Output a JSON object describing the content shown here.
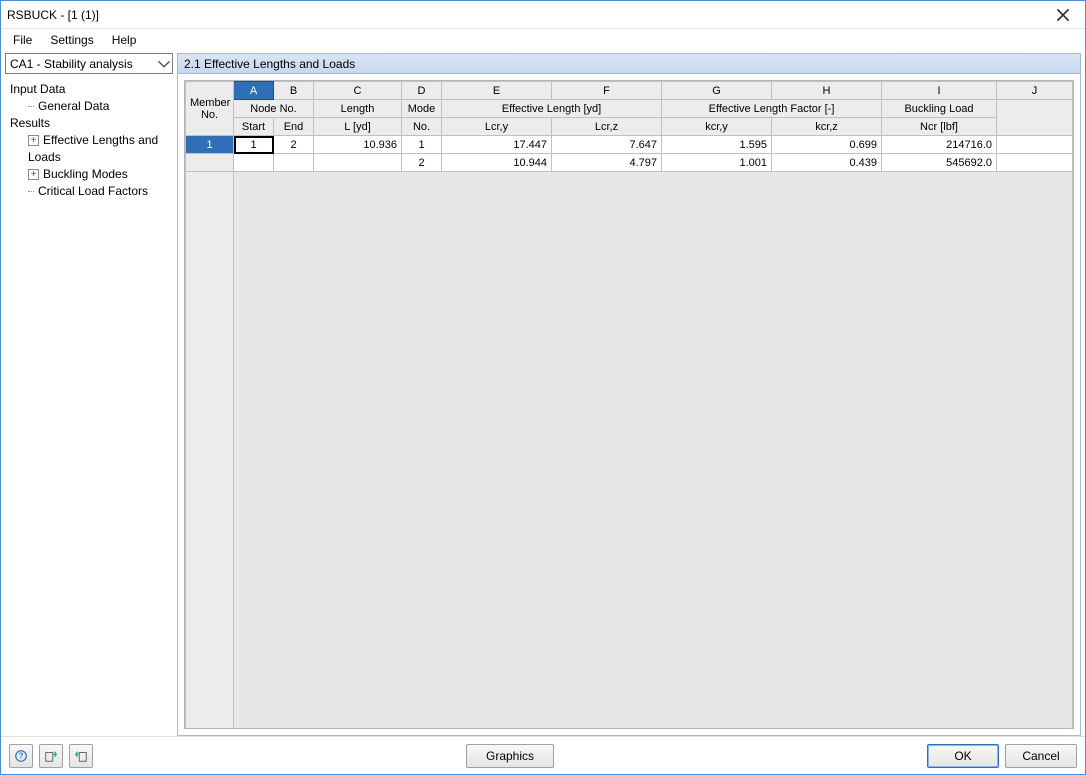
{
  "window": {
    "title": "RSBUCK - [1 (1)]"
  },
  "menu": {
    "file": "File",
    "settings": "Settings",
    "help": "Help"
  },
  "sidebar": {
    "combo": "CA1 - Stability analysis",
    "input_data": "Input Data",
    "general_data": "General Data",
    "results": "Results",
    "eff_lengths": "Effective Lengths and Loads",
    "buckling_modes": "Buckling Modes",
    "critical_load": "Critical Load Factors"
  },
  "main": {
    "heading": "2.1 Effective Lengths and Loads",
    "letters": {
      "A": "A",
      "B": "B",
      "C": "C",
      "D": "D",
      "E": "E",
      "F": "F",
      "G": "G",
      "H": "H",
      "I": "I",
      "J": "J"
    },
    "h1": {
      "member_no": "Member",
      "node_no": "Node No.",
      "length": "Length",
      "mode": "Mode",
      "eff_len": "Effective Length [yd]",
      "eff_fac": "Effective Length Factor [-]",
      "buck": "Buckling Load",
      "j": ""
    },
    "h2": {
      "no": "No.",
      "start": "Start",
      "end": "End",
      "lyd": "L [yd]",
      "mode_no": "No.",
      "lcry": "Lcr,y",
      "lcrz": "Lcr,z",
      "kcry": "kcr,y",
      "kcrz": "kcr,z",
      "ncr": "Ncr [lbf]"
    },
    "rows": [
      {
        "member": "1",
        "start": "1",
        "end": "2",
        "l": "10.936",
        "mode": "1",
        "lcry": "17.447",
        "lcrz": "7.647",
        "kcry": "1.595",
        "kcrz": "0.699",
        "ncr": "214716.0"
      },
      {
        "member": "",
        "start": "",
        "end": "",
        "l": "",
        "mode": "2",
        "lcry": "10.944",
        "lcrz": "4.797",
        "kcry": "1.001",
        "kcrz": "0.439",
        "ncr": "545692.0"
      }
    ]
  },
  "footer": {
    "graphics": "Graphics",
    "ok": "OK",
    "cancel": "Cancel"
  }
}
